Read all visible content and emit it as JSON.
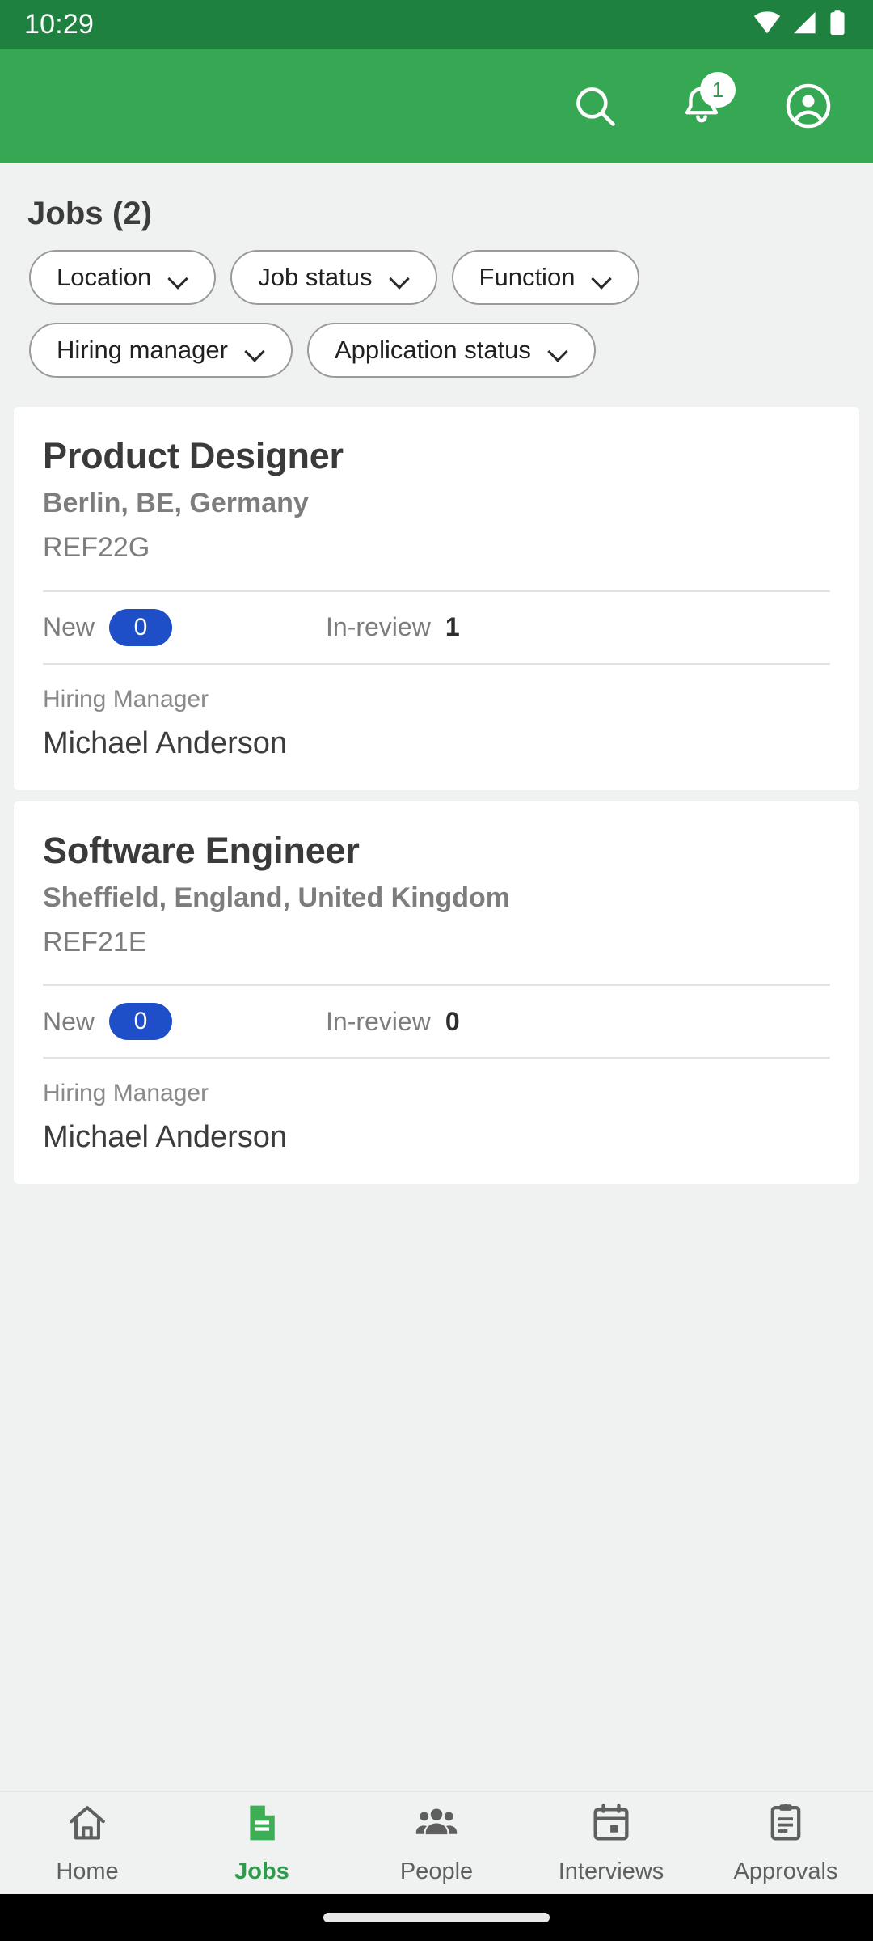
{
  "status_bar": {
    "time": "10:29",
    "icons": [
      "wifi-icon",
      "cellular-signal-icon",
      "battery-icon"
    ]
  },
  "app_bar": {
    "background_color": "#36A853",
    "actions": [
      {
        "name": "search-icon",
        "label": "Search"
      },
      {
        "name": "notifications-icon",
        "label": "Notifications",
        "badge": "1"
      },
      {
        "name": "account-circle-icon",
        "label": "Account"
      }
    ]
  },
  "main": {
    "page_title": "Jobs (2)",
    "filters": [
      {
        "label": "Location"
      },
      {
        "label": "Job status"
      },
      {
        "label": "Function"
      },
      {
        "label": "Hiring manager"
      },
      {
        "label": "Application status"
      }
    ],
    "hiring_manager_label": "Hiring Manager",
    "stat_labels": {
      "new": "New",
      "in_review": "In-review"
    },
    "jobs": [
      {
        "title": "Product Designer",
        "location": "Berlin, BE, Germany",
        "ref": "REF22G",
        "new_count": "0",
        "in_review_count": "1",
        "hiring_manager": "Michael Anderson"
      },
      {
        "title": "Software Engineer",
        "location": "Sheffield, England, United Kingdom",
        "ref": "REF21E",
        "new_count": "0",
        "in_review_count": "0",
        "hiring_manager": "Michael Anderson"
      }
    ]
  },
  "bottom_nav": {
    "active": "Jobs",
    "active_color": "#2E9B4C",
    "items": [
      {
        "label": "Home",
        "icon": "home-icon"
      },
      {
        "label": "Jobs",
        "icon": "document-icon"
      },
      {
        "label": "People",
        "icon": "people-icon"
      },
      {
        "label": "Interviews",
        "icon": "calendar-icon"
      },
      {
        "label": "Approvals",
        "icon": "clipboard-icon"
      }
    ]
  },
  "colors": {
    "status_bar": "#1F8140",
    "app_bar": "#36A853",
    "background": "#EFF2F0",
    "card": "#FFFFFF",
    "badge_blue": "#1E4FC8"
  }
}
